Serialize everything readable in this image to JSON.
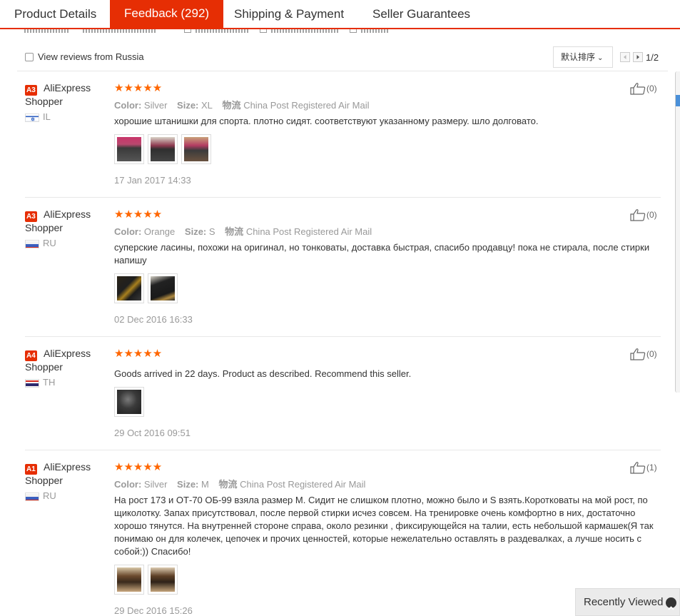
{
  "tabs": [
    {
      "label": "Product Details"
    },
    {
      "label": "Feedback (292)"
    },
    {
      "label": "Shipping & Payment"
    },
    {
      "label": "Seller Guarantees"
    }
  ],
  "toolbar": {
    "view_russia_label": "View reviews from Russia",
    "sort_value": "默认排序",
    "page_text": "1/2"
  },
  "reviews": [
    {
      "badge": "A3",
      "user_line1": "AliExpress",
      "user_line2": "Shopper",
      "country": "IL",
      "stars": "★★★★★",
      "color_label": "Color:",
      "color": "Silver",
      "size_label": "Size:",
      "size": "XL",
      "ship_label": "物流",
      "shipping": "China Post Registered Air Mail",
      "text": "хорошие штанишки для спорта. плотно сидят. соответствуют указанному размеру. шло долговато.",
      "date": "17 Jan 2017 14:33",
      "helpful": "(0)"
    },
    {
      "badge": "A3",
      "user_line1": "AliExpress",
      "user_line2": "Shopper",
      "country": "RU",
      "stars": "★★★★★",
      "color_label": "Color:",
      "color": "Orange",
      "size_label": "Size:",
      "size": "S",
      "ship_label": "物流",
      "shipping": "China Post Registered Air Mail",
      "text": "суперские ласины, похожи на оригинал, но тонковаты, доставка быстрая, спасибо продавцу! пока не стирала, после стирки напишу",
      "date": "02 Dec 2016 16:33",
      "helpful": "(0)"
    },
    {
      "badge": "A4",
      "user_line1": "AliExpress",
      "user_line2": "Shopper",
      "country": "TH",
      "stars": "★★★★★",
      "text": "Goods arrived in 22 days. Product as described. Recommend this seller.",
      "date": "29 Oct 2016 09:51",
      "helpful": "(0)"
    },
    {
      "badge": "A1",
      "user_line1": "AliExpress",
      "user_line2": "Shopper",
      "country": "RU",
      "stars": "★★★★★",
      "color_label": "Color:",
      "color": "Silver",
      "size_label": "Size:",
      "size": "M",
      "ship_label": "物流",
      "shipping": "China Post Registered Air Mail",
      "text": "На рост 173 и ОТ-70 ОБ-99 взяла размер М. Сидит не слишком плотно, можно было и S взять.Коротковаты на мой рост, по щиколотку. Запах присутствовал, после первой стирки исчез совсем. На тренировке очень комфортно в них, достаточно хорошо тянутся. На внутренней стороне справа, около резинки , фиксирующейся на талии, есть небольшой кармашек(Я так понимаю он для колечек, цепочек и прочих ценностей, которые нежелательно оставлять в раздевалках, а лучше носить с собой:)) Спасибо!",
      "date": "29 Dec 2016 15:26",
      "helpful": "(1)"
    }
  ],
  "recently_viewed": "Recently Viewed",
  "colors": {
    "accent": "#e62e04",
    "star": "#ff6600"
  }
}
